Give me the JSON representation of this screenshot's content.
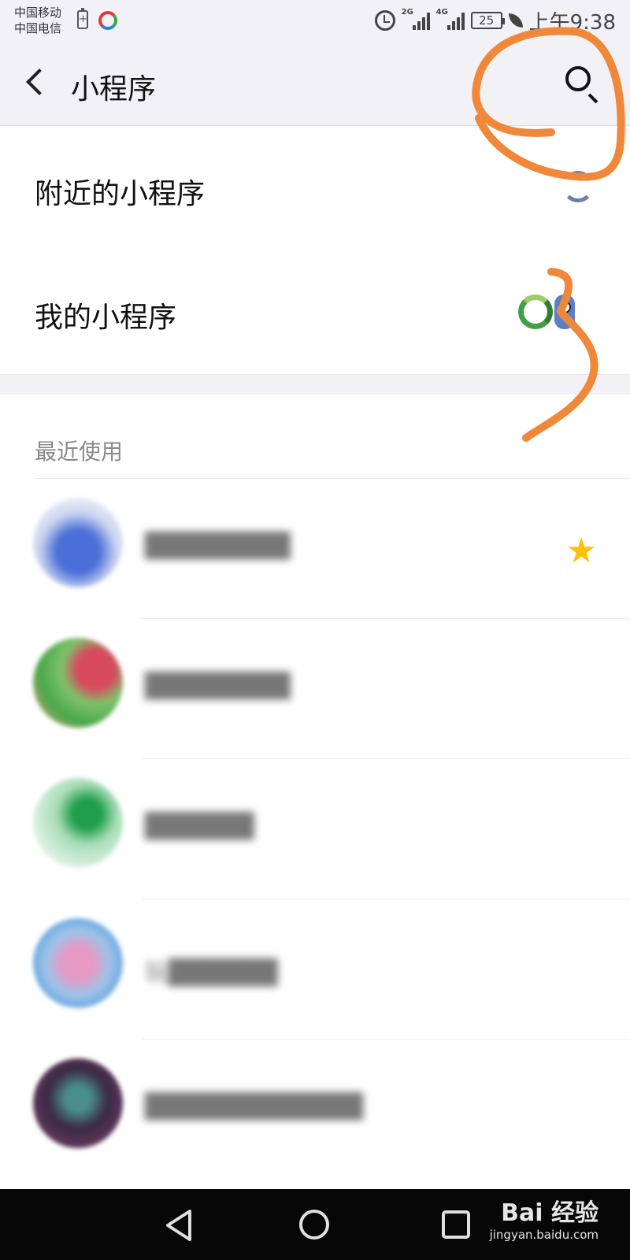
{
  "status_bar": {
    "carrier_1": "中国移动",
    "carrier_2": "中国电信",
    "network_1": "2G",
    "network_2": "4G",
    "battery": "25",
    "time": "上午9:38"
  },
  "header": {
    "title": "小程序",
    "back_icon": "chevron-left-icon",
    "search_icon": "search-icon"
  },
  "entries": {
    "nearby_label": "附近的小程序",
    "mine_label": "我的小程序"
  },
  "recent": {
    "section_label": "最近使用",
    "items": [
      {
        "name": "████████",
        "starred": true
      },
      {
        "name": "████████"
      },
      {
        "name": "██████"
      },
      {
        "name": "玩██████"
      },
      {
        "name": "████████████"
      }
    ]
  },
  "nav": {
    "watermark_main": "Bai 经验",
    "watermark_sub": "jingyan.baidu.com"
  },
  "colors": {
    "header_bg": "#f2f1f5",
    "annotation": "#f0883a",
    "star": "#ffc107",
    "nav_bg": "#070707"
  }
}
